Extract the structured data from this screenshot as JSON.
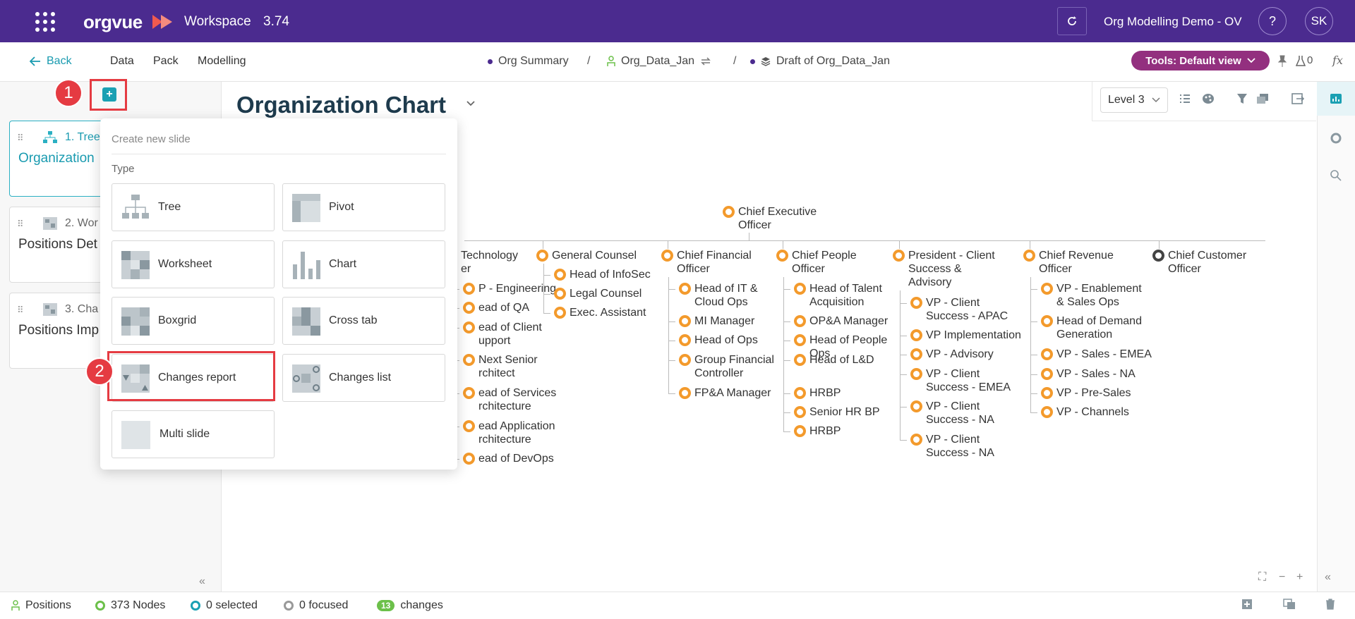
{
  "header": {
    "logo": "orgvue",
    "workspace_label": "Workspace",
    "version": "3.74",
    "org_name": "Org Modelling Demo - OV",
    "help": "?",
    "avatar_initials": "SK",
    "bg_color": "#4b2b8f"
  },
  "nav": {
    "back": "Back",
    "links": [
      "Data",
      "Pack",
      "Modelling"
    ],
    "breadcrumbs": [
      "Org Summary",
      "Org_Data_Jan",
      "Draft of Org_Data_Jan"
    ],
    "tools_label": "Tools: Default view",
    "flask_count": "0",
    "fx": "fx"
  },
  "sidebar": {
    "slides": [
      {
        "num": "1. Tree",
        "title": "Organization"
      },
      {
        "num": "2. Wor",
        "title": "Positions Det"
      },
      {
        "num": "3. Cha",
        "title": "Positions Imp"
      }
    ]
  },
  "main": {
    "title": "Organization Chart",
    "level": "Level 3"
  },
  "popup": {
    "heading": "Create new slide",
    "type_label": "Type",
    "options": [
      "Tree",
      "Pivot",
      "Worksheet",
      "Chart",
      "Boxgrid",
      "Cross tab",
      "Changes report",
      "Changes list",
      "Multi slide"
    ]
  },
  "callouts": [
    "1",
    "2"
  ],
  "org": {
    "root": [
      "Chief Executive",
      "Officer"
    ],
    "columns": [
      {
        "head": [
          "Technology",
          "er"
        ],
        "children": [
          [
            "P - Engineering"
          ],
          [
            "ead of QA"
          ],
          [
            "ead of Client",
            "upport"
          ],
          [
            "Next Senior",
            "rchitect"
          ],
          [
            "ead of Services",
            "rchitecture"
          ],
          [
            "ead Application",
            "rchitecture"
          ],
          [
            "ead of DevOps"
          ]
        ]
      },
      {
        "head": [
          "General Counsel"
        ],
        "children": [
          [
            "Head of InfoSec"
          ],
          [
            "Legal Counsel"
          ],
          [
            "Exec. Assistant"
          ]
        ]
      },
      {
        "head": [
          "Chief Financial",
          "Officer"
        ],
        "children": [
          [
            "Head of IT &",
            "Cloud Ops"
          ],
          [
            "MI Manager"
          ],
          [
            "Head of Ops"
          ],
          [
            "Group Financial",
            "Controller"
          ],
          [
            "FP&A Manager"
          ]
        ]
      },
      {
        "head": [
          "Chief People",
          "Officer"
        ],
        "children": [
          [
            "Head of Talent",
            "Acquisition"
          ],
          [
            "OP&A Manager"
          ],
          [
            "Head of People",
            "Ops"
          ],
          [
            "Head of L&D"
          ],
          [
            "HRBP"
          ],
          [
            "Senior HR BP"
          ],
          [
            "HRBP"
          ]
        ]
      },
      {
        "head": [
          "President -  Client",
          "Success &",
          "Advisory"
        ],
        "children": [
          [
            "VP - Client",
            "Success - APAC"
          ],
          [
            "VP Implementation"
          ],
          [
            "VP - Advisory"
          ],
          [
            "VP - Client",
            "Success - EMEA"
          ],
          [
            "VP - Client",
            "Success - NA"
          ],
          [
            "VP - Client",
            "Success - NA"
          ]
        ]
      },
      {
        "head": [
          "Chief Revenue",
          "Officer"
        ],
        "children": [
          [
            "VP - Enablement",
            "& Sales Ops"
          ],
          [
            "Head of Demand",
            "Generation"
          ],
          [
            "VP - Sales - EMEA"
          ],
          [
            "VP - Sales - NA"
          ],
          [
            "VP - Pre-Sales"
          ],
          [
            "VP - Channels"
          ]
        ]
      },
      {
        "head": [
          "Chief Customer",
          "Officer"
        ],
        "children": []
      }
    ]
  },
  "status": {
    "positions": "Positions",
    "nodes": "373 Nodes",
    "selected": "0 selected",
    "focused": "0 focused",
    "changes_count": "13",
    "changes_label": "changes"
  },
  "colors": {
    "accent": "#1aa0b3",
    "node": "#f39a2c",
    "callout": "#e53b42",
    "tools": "#93307f"
  }
}
